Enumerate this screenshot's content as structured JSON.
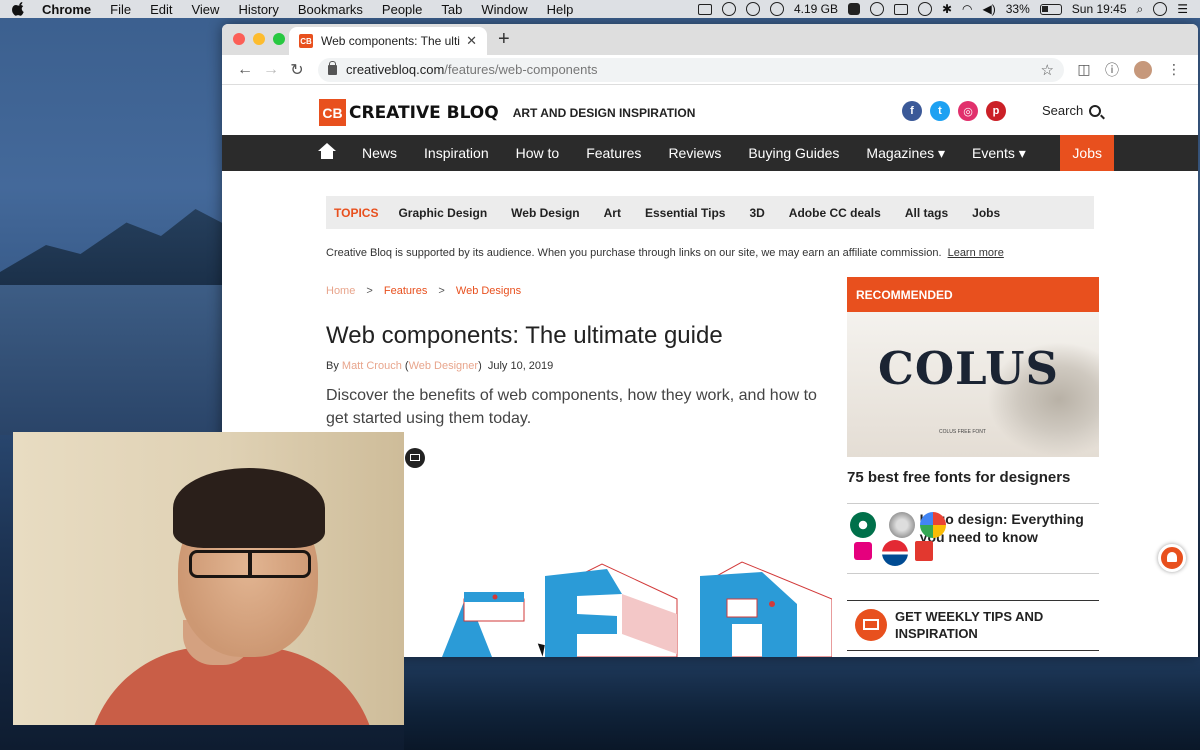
{
  "menubar": {
    "app": "Chrome",
    "items": [
      "File",
      "Edit",
      "View",
      "History",
      "Bookmarks",
      "People",
      "Tab",
      "Window",
      "Help"
    ],
    "memory": "4.19 GB",
    "battery": "33%",
    "clock": "Sun 19:45"
  },
  "browser": {
    "tab_title": "Web components: The ultimate",
    "tab_favicon": "CB",
    "url_host": "creativebloq.com",
    "url_path": "/features/web-components"
  },
  "site": {
    "logo_mark": "CB",
    "logo_text": "CREATIVE BLOQ",
    "tagline": "ART AND DESIGN INSPIRATION",
    "social": [
      "f",
      "t",
      "◎",
      "p"
    ],
    "search": "Search",
    "nav": [
      "News",
      "Inspiration",
      "How to",
      "Features",
      "Reviews",
      "Buying Guides",
      "Magazines ▾",
      "Events ▾"
    ],
    "nav_jobs": "Jobs",
    "topics_label": "TOPICS",
    "topics": [
      "Graphic Design",
      "Web Design",
      "Art",
      "Essential Tips",
      "3D",
      "Adobe CC deals",
      "All tags",
      "Jobs"
    ],
    "affiliate_text": "Creative Bloq is supported by its audience. When you purchase through links on our site, we may earn an affiliate commission.",
    "affiliate_link": "Learn more"
  },
  "article": {
    "breadcrumbs": [
      "Home",
      ">",
      "Features",
      ">",
      "Web Designs"
    ],
    "title": "Web components: The ultimate guide",
    "by": "By",
    "author": "Matt Crouch",
    "publication": "Web Designer",
    "date": "July 10, 2019",
    "standfirst": "Discover the benefits of web components, how they work, and how to get started using them today."
  },
  "sidebar": {
    "recommended_label": "RECOMMENDED",
    "promo_word": "COLUS",
    "promo_caption": "COLUS FREE FONT",
    "rec_title": "75 best free fonts for designers",
    "logo_card_title": "Logo design: Everything you need to know",
    "newsletter": "GET WEEKLY TIPS AND INSPIRATION"
  },
  "colors": {
    "brand": "#e8501e",
    "nav_bg": "#2b2b2b"
  }
}
